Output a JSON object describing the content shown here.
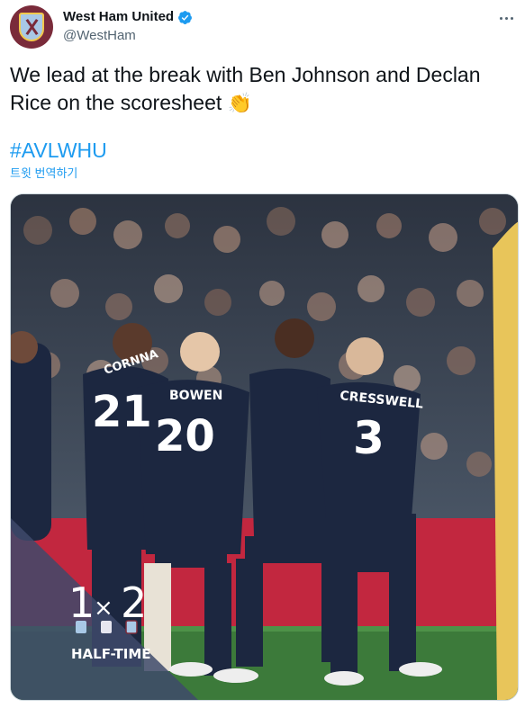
{
  "account": {
    "display_name": "West Ham United",
    "handle": "@WestHam"
  },
  "tweet": {
    "text": "We lead at the break with Ben Johnson and Declan Rice on the scoresheet",
    "emoji": "👏",
    "hashtag": "#AVLWHU",
    "translate_label": "트윗 번역하기"
  },
  "media": {
    "players": [
      {
        "number": "21",
        "name": "CORNNA"
      },
      {
        "number": "20",
        "name": "BOWEN"
      },
      {
        "number": "3",
        "name": "CRESSWELL"
      }
    ],
    "score": {
      "home": "1",
      "away": "2"
    },
    "status": "HALF-TIME",
    "colors": {
      "kit": "#1c2740",
      "pitch": "#3c7a3a",
      "overlay": "#3e4a6b",
      "claret": "#7a2b3a"
    }
  }
}
